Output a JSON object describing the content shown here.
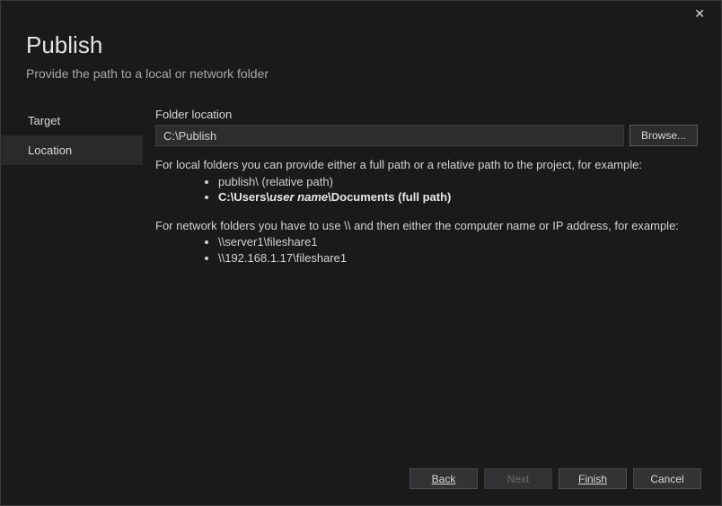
{
  "window": {
    "title": "Publish",
    "subtitle": "Provide the path to a local or network folder"
  },
  "nav": {
    "items": [
      {
        "label": "Target",
        "selected": false
      },
      {
        "label": "Location",
        "selected": true
      }
    ]
  },
  "content": {
    "folder_label": "Folder location",
    "folder_value": "C:\\Publish",
    "browse_label": "Browse...",
    "help_local_intro": "For local folders you can provide either a full path or a relative path to the project, for example:",
    "help_local_ex1": "publish\\ (relative path)",
    "help_full_prefix": "C:\\Users\\",
    "help_full_username": "user name",
    "help_full_suffix": "\\Documents (full path)",
    "help_network_intro": "For network folders you have to use \\\\ and then either the computer name or IP address, for example:",
    "help_net_ex1": "\\\\server1\\fileshare1",
    "help_net_ex2": "\\\\192.168.1.17\\fileshare1"
  },
  "footer": {
    "back": "Back",
    "next": "Next",
    "finish": "Finish",
    "cancel": "Cancel"
  }
}
